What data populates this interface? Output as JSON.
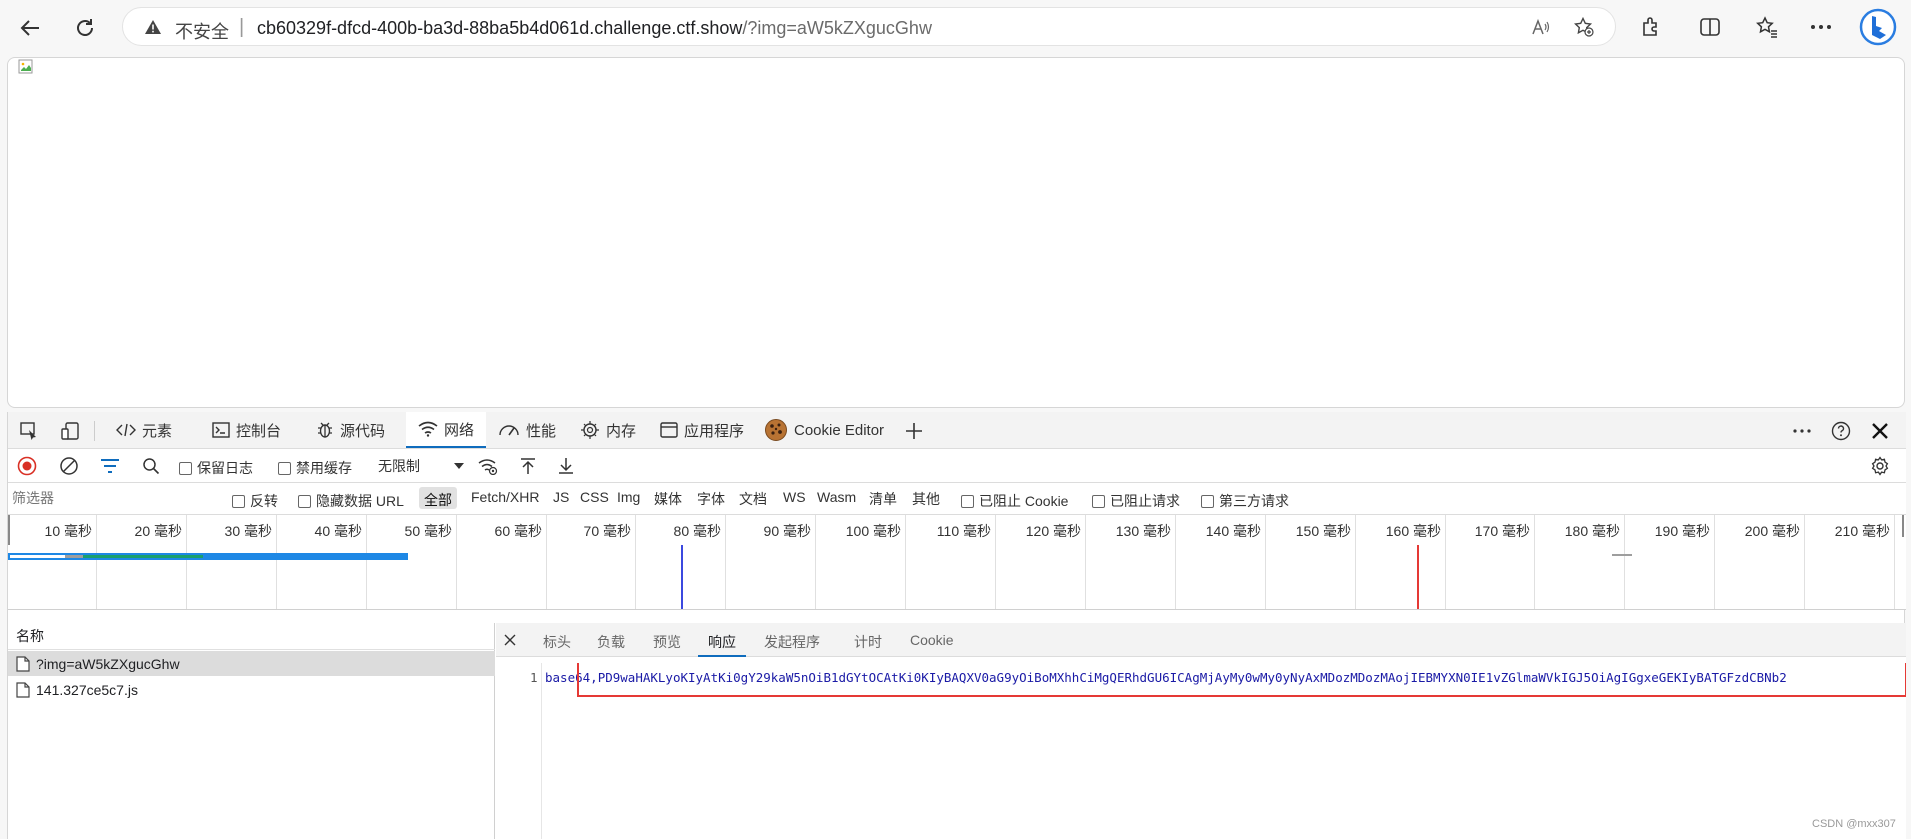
{
  "browser": {
    "security_label": "不安全",
    "url_host": "cb60329f-dfcd-400b-ba3d-88ba5b4d061d.challenge.ctf.show",
    "url_path": "/?img=aW5kZXgucGhw"
  },
  "devtools": {
    "tabs": [
      "元素",
      "控制台",
      "源代码",
      "网络",
      "性能",
      "内存",
      "应用程序",
      "Cookie Editor"
    ],
    "toolbar": {
      "preserve_log": "保留日志",
      "disable_cache": "禁用缓存",
      "throttle": "无限制"
    },
    "filter": {
      "placeholder": "筛选器",
      "invert": "反转",
      "hide_data_url": "隐藏数据 URL",
      "types": [
        "全部",
        "Fetch/XHR",
        "JS",
        "CSS",
        "Img",
        "媒体",
        "字体",
        "文档",
        "WS",
        "Wasm",
        "清单",
        "其他"
      ],
      "blocked_cookie": "已阻止 Cookie",
      "blocked_requests": "已阻止请求",
      "third_party": "第三方请求"
    },
    "timeline_ticks": [
      "10 毫秒",
      "20 毫秒",
      "30 毫秒",
      "40 毫秒",
      "50 毫秒",
      "60 毫秒",
      "70 毫秒",
      "80 毫秒",
      "90 毫秒",
      "100 毫秒",
      "110 毫秒",
      "120 毫秒",
      "130 毫秒",
      "140 毫秒",
      "150 毫秒",
      "160 毫秒",
      "170 毫秒",
      "180 毫秒",
      "190 毫秒",
      "200 毫秒",
      "210 毫秒"
    ],
    "name_header": "名称",
    "requests": [
      {
        "name": "?img=aW5kZXgucGhw"
      },
      {
        "name": "141.327ce5c7.js"
      }
    ],
    "detail_tabs": [
      "标头",
      "负载",
      "预览",
      "响应",
      "发起程序",
      "计时",
      "Cookie"
    ],
    "response": {
      "line_number": "1",
      "prefix": "base64,",
      "content": "PD9waHAKLyoKIyAtKi0gY29kaW5nOiB1dGYtOCAtKi0KIyBAQXV0aG9yOiBoMXhhCiMgQERhdGU6ICAgMjAyMy0wMy0yNyAxMDozMDozMAojIEBMYXN0IE1vZGlmaWVkIGJ5OiAgIGgxeGEKIyBATGFzdCBNb2"
    }
  },
  "watermark": "CSDN @mxx307"
}
